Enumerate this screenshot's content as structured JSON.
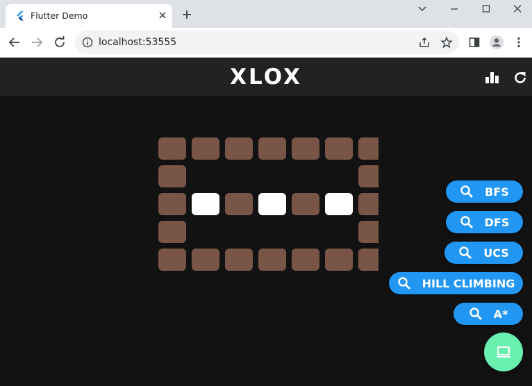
{
  "browser": {
    "tab_title": "Flutter Demo",
    "url": "localhost:53555"
  },
  "app": {
    "title": "XLOX",
    "colors": {
      "wall": "#795548",
      "empty": "#ffffff",
      "search_button": "#2196f3",
      "run_button": "#69f0ae",
      "background": "#121212",
      "appbar": "#222222"
    },
    "appbar_icons": [
      "bar-chart-icon",
      "refresh-icon"
    ],
    "grid": {
      "rows": 5,
      "visible_columns": 7,
      "cells": [
        [
          "wall",
          "wall",
          "wall",
          "wall",
          "wall",
          "wall",
          "wall"
        ],
        [
          "wall",
          "none",
          "none",
          "none",
          "none",
          "none",
          "wall"
        ],
        [
          "wall",
          "empty",
          "wall",
          "empty",
          "wall",
          "empty",
          "wall"
        ],
        [
          "wall",
          "none",
          "none",
          "none",
          "none",
          "none",
          "wall"
        ],
        [
          "wall",
          "wall",
          "wall",
          "wall",
          "wall",
          "wall",
          "wall"
        ]
      ]
    },
    "search_buttons": [
      {
        "label": "BFS",
        "icon": "search-icon"
      },
      {
        "label": "DFS",
        "icon": "search-icon"
      },
      {
        "label": "UCS",
        "icon": "search-icon"
      },
      {
        "label": "HILL CLIMBING",
        "icon": "search-icon"
      },
      {
        "label": "A*",
        "icon": "search-icon"
      }
    ],
    "run_button": {
      "icon": "laptop-icon"
    }
  }
}
